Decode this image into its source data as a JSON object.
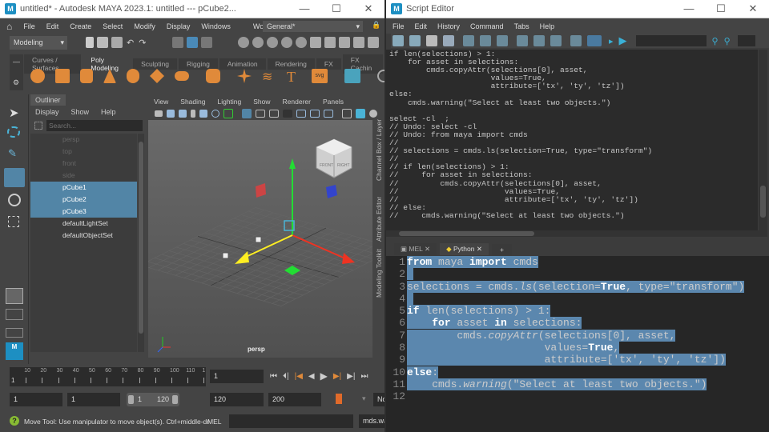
{
  "maya": {
    "title": "untitled* - Autodesk MAYA 2023.1: untitled   ---   pCube2...",
    "menu": [
      "File",
      "Edit",
      "Create",
      "Select",
      "Modify",
      "Display",
      "Windows"
    ],
    "workspace_label": "Workspace:",
    "workspace_value": "General*",
    "menuset": "Modeling",
    "shelf_tabs": [
      "Curves / Surfaces",
      "Poly Modeling",
      "Sculpting",
      "Rigging",
      "Animation",
      "Rendering",
      "FX",
      "FX Cachin"
    ],
    "active_shelf": "Poly Modeling",
    "outliner": {
      "tab": "Outliner",
      "menu": [
        "Display",
        "Show",
        "Help"
      ],
      "search_placeholder": "Search...",
      "items": [
        {
          "name": "persp",
          "state": "dim"
        },
        {
          "name": "top",
          "state": "dim"
        },
        {
          "name": "front",
          "state": "dim"
        },
        {
          "name": "side",
          "state": "dim"
        },
        {
          "name": "pCube1",
          "state": "selected"
        },
        {
          "name": "pCube2",
          "state": "selected"
        },
        {
          "name": "pCube3",
          "state": "selected"
        },
        {
          "name": "defaultLightSet",
          "state": "normal"
        },
        {
          "name": "defaultObjectSet",
          "state": "normal"
        }
      ]
    },
    "viewport": {
      "menu": [
        "View",
        "Shading",
        "Lighting",
        "Show",
        "Renderer",
        "Panels"
      ],
      "camera": "persp",
      "cube_front": "FRONT",
      "cube_right": "RIGHT"
    },
    "side_tabs": [
      "Channel Box / Layer Editor",
      "Attribute Editor",
      "Modeling Toolkit"
    ],
    "timeline": {
      "ticks": [
        "10",
        "20",
        "30",
        "40",
        "50",
        "60",
        "70",
        "80",
        "90",
        "100",
        "110",
        "1"
      ],
      "start_label": "1",
      "current_frame": "1"
    },
    "range": {
      "start": "1",
      "playback_start": "1",
      "slider_start": "1",
      "slider_end": "120",
      "playback_end": "120",
      "end": "200",
      "extra": "No"
    },
    "status": {
      "help": "Move Tool: Use manipulator to move object(s). Ctrl+middle-dr",
      "cmd_lang": "MEL",
      "cmd_result": "mds.wa"
    }
  },
  "script_editor": {
    "title": "Script Editor",
    "menu": [
      "File",
      "Edit",
      "History",
      "Command",
      "Tabs",
      "Help"
    ],
    "output": "if len(selections) > 1:\n    for asset in selections:\n        cmds.copyAttr(selections[0], asset,\n                      values=True,\n                      attribute=['tx', 'ty', 'tz'])\nelse:\n    cmds.warning(\"Select at least two objects.\")\n\nselect -cl  ;\n// Undo: select -cl\n// Undo: from maya import cmds\n//\n// selections = cmds.ls(selection=True, type=\"transform\")\n//\n// if len(selections) > 1:\n//     for asset in selections:\n//         cmds.copyAttr(selections[0], asset,\n//                       values=True,\n//                       attribute=['tx', 'ty', 'tz'])\n// else:\n//     cmds.warning(\"Select at least two objects.\")",
    "tabs": [
      "MEL",
      "Python",
      "+"
    ],
    "active_tab": "Python",
    "line_numbers": [
      "1",
      "2",
      "3",
      "4",
      "5",
      "6",
      "7",
      "8",
      "9",
      "10",
      "11",
      "12"
    ]
  },
  "colors": {
    "selection": "#5b87ae",
    "accent": "#e08a3a",
    "outliner_selected": "#5285a6"
  }
}
